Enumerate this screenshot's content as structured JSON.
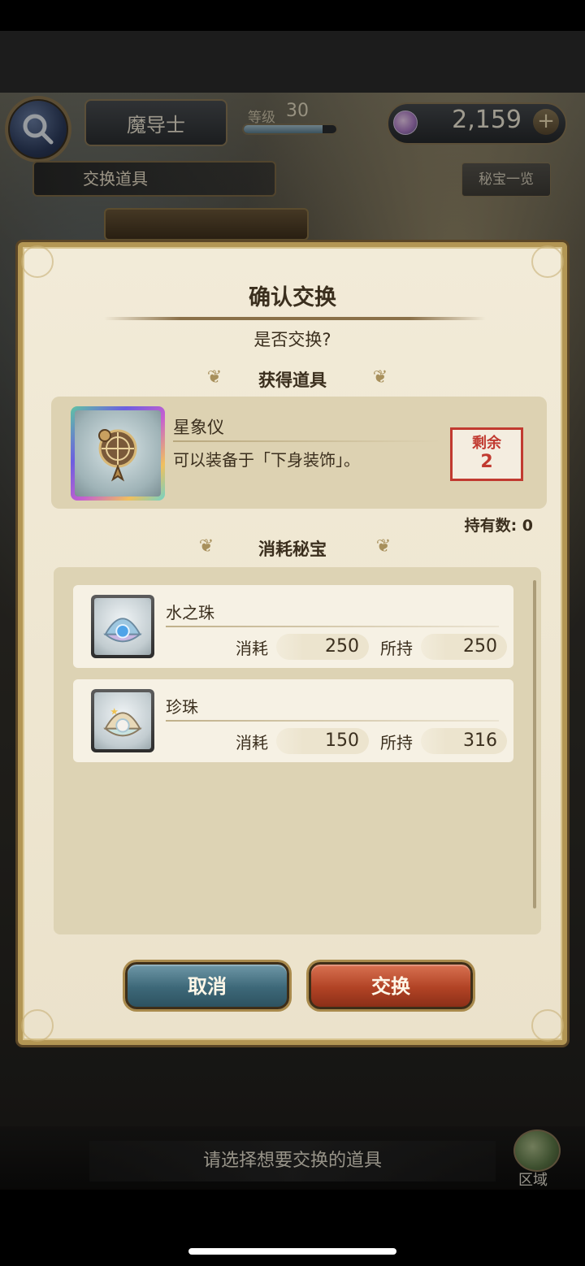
{
  "header": {
    "class_name": "魔导士",
    "level_label": "等级",
    "level_value": "30",
    "currency_value": "2,159",
    "currency_icon": "gem-icon",
    "plus_label": "+",
    "xp_fraction": 0.85
  },
  "section_title": "交换道具",
  "treasure_list_label": "秘宝一览",
  "modal": {
    "title": "确认交换",
    "question": "是否交换?",
    "reward_heading": "获得道具",
    "reward": {
      "name": "星象仪",
      "description": "可以装备于「下身装饰」。",
      "remaining_label": "剩余",
      "remaining_value": "2",
      "icon": "astrolabe-icon"
    },
    "owned_count": "持有数: 0",
    "cost_heading": "消耗秘宝",
    "costs": [
      {
        "name": "水之珠",
        "consume_label": "消耗",
        "consume_value": "250",
        "own_label": "所持",
        "own_value": "250",
        "icon": "water-pearl-shell-icon"
      },
      {
        "name": "珍珠",
        "consume_label": "消耗",
        "consume_value": "150",
        "own_label": "所持",
        "own_value": "316",
        "icon": "pearl-shell-icon"
      }
    ],
    "cancel_label": "取消",
    "exchange_label": "交换"
  },
  "footer": {
    "hint": "请选择想要交换的道具",
    "region_label": "区域"
  },
  "colors": {
    "remaining_red": "#c13a30",
    "cancel_button": "#3d6878",
    "exchange_button": "#b14325",
    "modal_frame": "#b39654"
  }
}
